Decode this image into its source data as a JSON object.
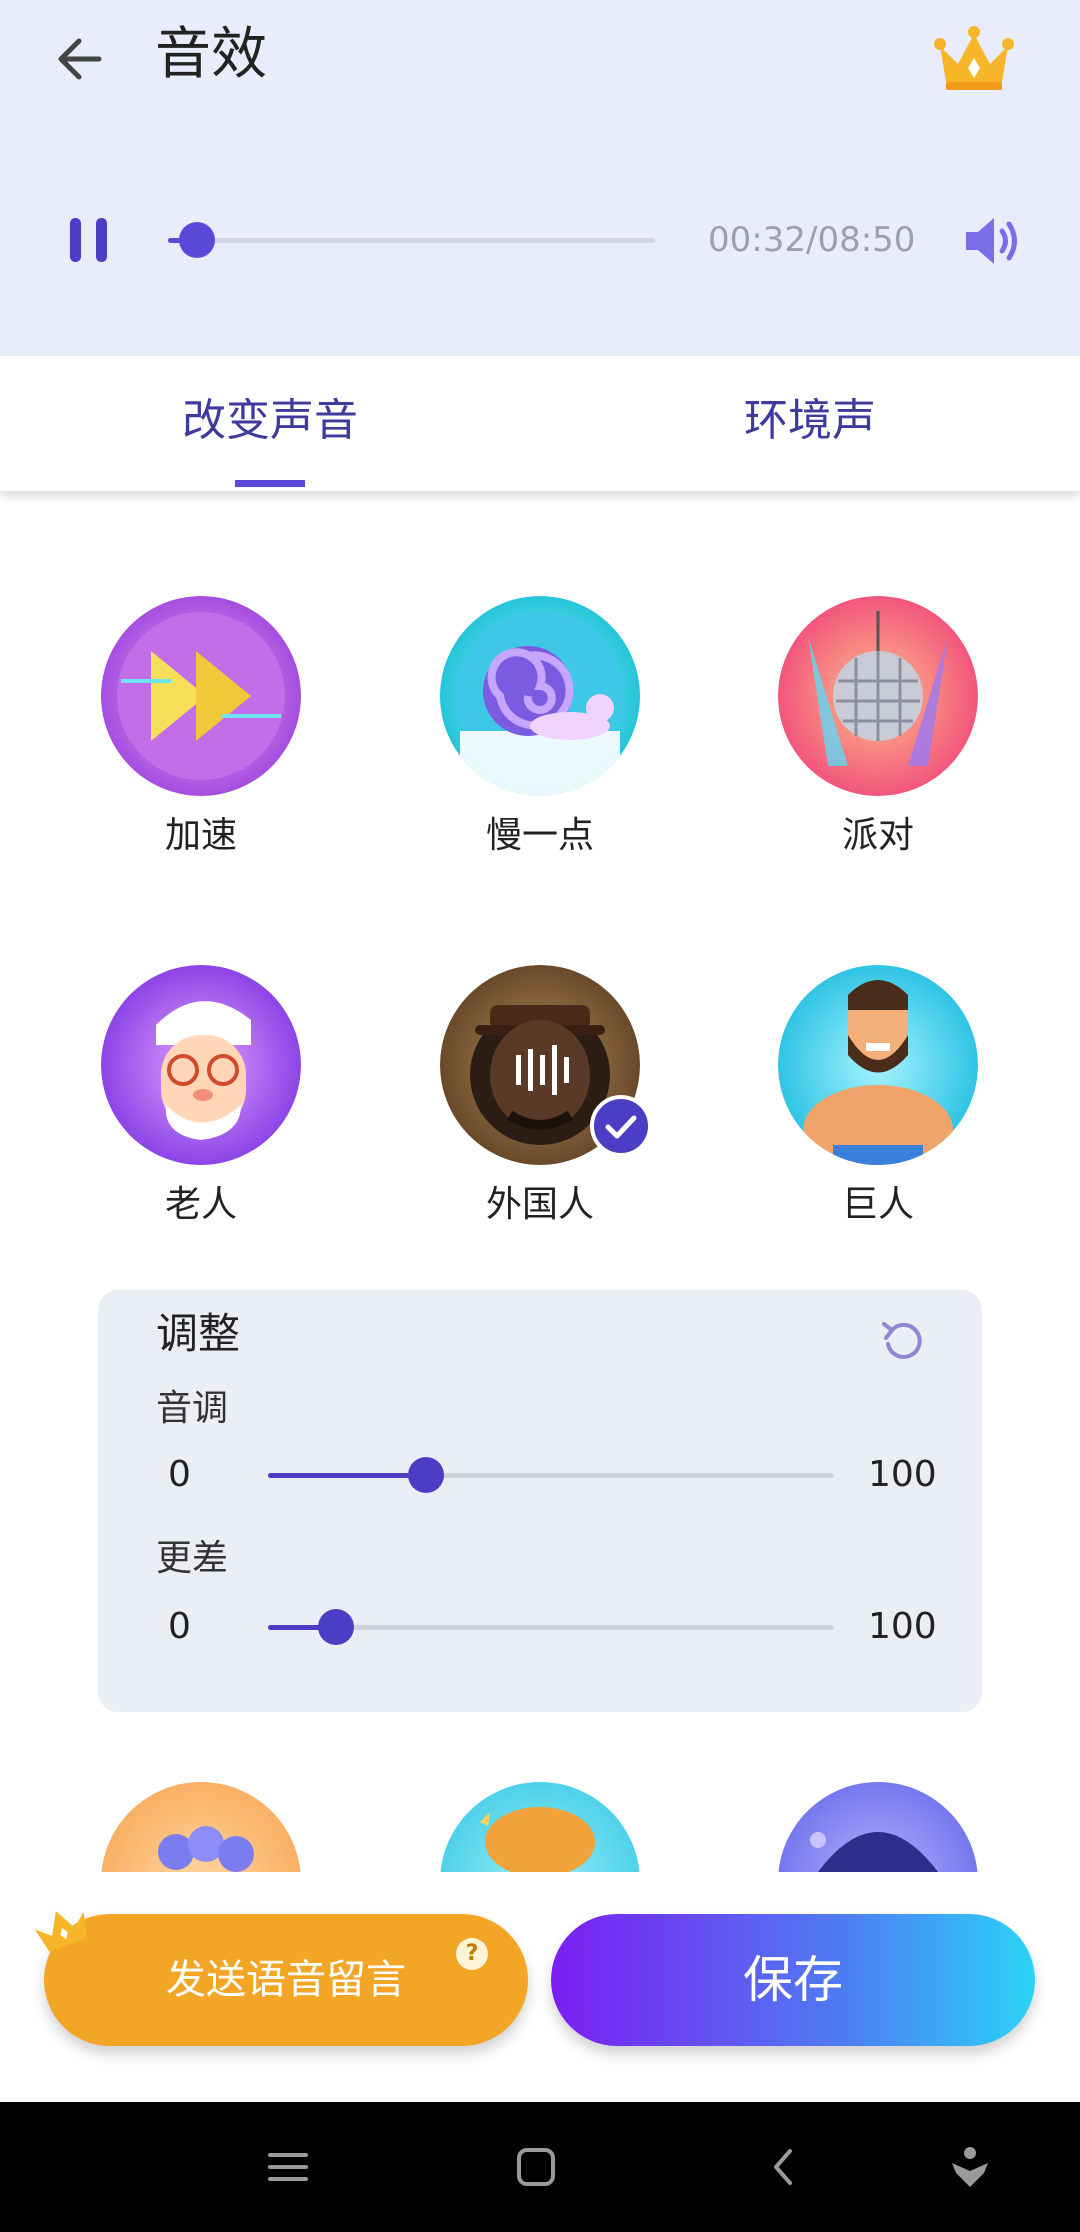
{
  "header": {
    "title": "音效",
    "back_icon": "arrow-left-icon",
    "premium_icon": "crown-icon"
  },
  "player": {
    "state_icon": "pause-icon",
    "time": "00:32/08:50",
    "progress": 0.06,
    "volume_icon": "volume-icon"
  },
  "tabs": [
    {
      "label": "改变声音",
      "active": true
    },
    {
      "label": "环境声",
      "active": false
    }
  ],
  "effects": [
    {
      "label": "加速",
      "icon": "fast-forward-icon",
      "selected": false
    },
    {
      "label": "慢一点",
      "icon": "snail-icon",
      "selected": false
    },
    {
      "label": "派对",
      "icon": "disco-ball-icon",
      "selected": false
    },
    {
      "label": "老人",
      "icon": "old-man-icon",
      "selected": false
    },
    {
      "label": "外国人",
      "icon": "foreigner-icon",
      "selected": true
    },
    {
      "label": "巨人",
      "icon": "giant-icon",
      "selected": false
    }
  ],
  "adjust": {
    "title": "调整",
    "reset_icon": "reset-icon",
    "sliders": [
      {
        "label": "音调",
        "min": "0",
        "max": "100",
        "value": 28
      },
      {
        "label": "更差",
        "min": "0",
        "max": "100",
        "value": 12
      }
    ]
  },
  "actions": {
    "send_label": "发送语音留言",
    "help_mark": "?",
    "save_label": "保存"
  },
  "colors": {
    "accent": "#5a49d6",
    "header_bg": "#e9ecfa",
    "send_button": "#f3a526"
  },
  "system_nav": [
    "menu-icon",
    "home-icon",
    "back-icon",
    "accessibility-icon"
  ]
}
